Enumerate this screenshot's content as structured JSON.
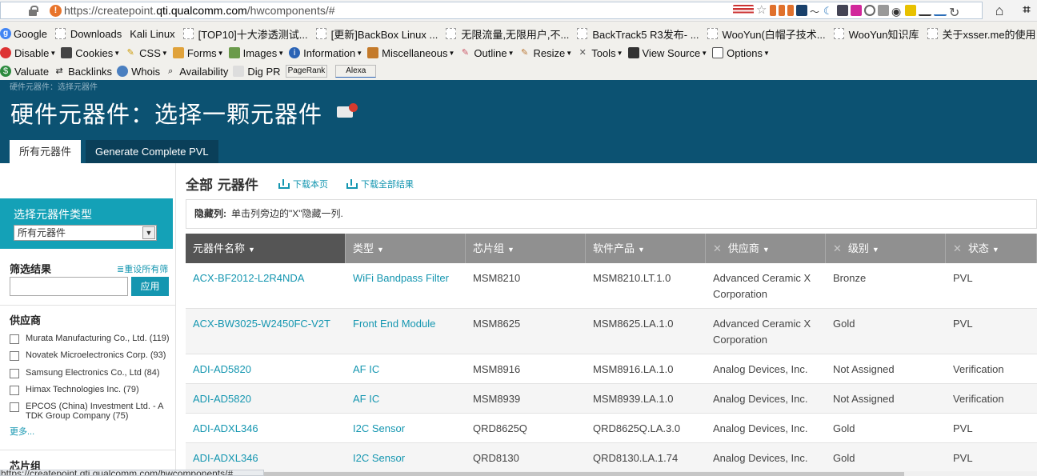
{
  "browser": {
    "url_prefix": "https://createpoint.",
    "url_host": "qti.qualcomm.com",
    "url_suffix": "/hwcomponents/#",
    "bookmarks": [
      {
        "label": "Google",
        "icon": "google-icon"
      },
      {
        "label": "Downloads",
        "icon": "page-icon"
      },
      {
        "label": "Kali Linux",
        "icon": "none"
      },
      {
        "label": "[TOP10]十大渗透测试...",
        "icon": "page-icon"
      },
      {
        "label": "[更新]BackBox Linux ...",
        "icon": "page-icon"
      },
      {
        "label": "无限流量,无限用户,不...",
        "icon": "page-icon"
      },
      {
        "label": "BackTrack5 R3发布- ...",
        "icon": "page-icon"
      },
      {
        "label": "WooYun(白帽子技术...",
        "icon": "page-icon"
      },
      {
        "label": "WooYun知识库",
        "icon": "page-icon"
      },
      {
        "label": "关于xsser.me的使用",
        "icon": "page-icon"
      }
    ],
    "toolbar1": [
      "Disable",
      "Cookies",
      "CSS",
      "Forms",
      "Images",
      "Information",
      "Miscellaneous",
      "Outline",
      "Resize",
      "Tools",
      "View Source",
      "Options"
    ],
    "toolbar2": [
      "Valuate",
      "Backlinks",
      "Whois",
      "Availability",
      "Dig PR"
    ],
    "rank_labels": [
      "PageRank",
      "Alexa"
    ],
    "status_url": "https://createpoint.qti.qualcomm.com/hwcomponents/#"
  },
  "header": {
    "breadcrumb": "硬件元器件：选择元器件",
    "title": "硬件元器件：选择一颗元器件",
    "tabs": [
      "所有元器件",
      "Generate Complete PVL"
    ]
  },
  "sidebar": {
    "type_label": "选择元器件类型",
    "type_value": "所有元器件",
    "filter_title": "筛选结果",
    "reset_label": "重设所有筛选",
    "apply_label": "应用",
    "supplier_title": "供应商",
    "suppliers": [
      "Murata Manufacturing Co., Ltd. (119)",
      "Novatek Microelectronics Corp. (93)",
      "Samsung Electronics Co., Ltd (84)",
      "Himax Technologies Inc. (79)",
      "EPCOS (China) Investment Ltd. - A TDK Group Company (75)"
    ],
    "more_label": "更多...",
    "chipset_title": "芯片组"
  },
  "main": {
    "title": "全部 元器件",
    "download_page": "下载本页",
    "download_all": "下载全部结果",
    "hide_label": "隐藏列:",
    "hide_text": "单击列旁边的\"X\"隐藏一列.",
    "columns": [
      "元器件名称",
      "类型",
      "芯片组",
      "软件产品",
      "供应商",
      "级别",
      "状态"
    ],
    "rows": [
      [
        "ACX-BF2012-L2R4NDA",
        "WiFi Bandpass Filter",
        "MSM8210",
        "MSM8210.LT.1.0",
        "Advanced Ceramic X Corporation",
        "Bronze",
        "PVL"
      ],
      [
        "ACX-BW3025-W2450FC-V2T",
        "Front End Module",
        "MSM8625",
        "MSM8625.LA.1.0",
        "Advanced Ceramic X Corporation",
        "Gold",
        "PVL"
      ],
      [
        "ADI-AD5820",
        "AF IC",
        "MSM8916",
        "MSM8916.LA.1.0",
        "Analog Devices, Inc.",
        "Not Assigned",
        "Verification"
      ],
      [
        "ADI-AD5820",
        "AF IC",
        "MSM8939",
        "MSM8939.LA.1.0",
        "Analog Devices, Inc.",
        "Not Assigned",
        "Verification"
      ],
      [
        "ADI-ADXL346",
        "I2C Sensor",
        "QRD8625Q",
        "QRD8625Q.LA.3.0",
        "Analog Devices, Inc.",
        "Gold",
        "PVL"
      ],
      [
        "ADI-ADXL346",
        "I2C Sensor",
        "QRD8130",
        "QRD8130.LA.1.74",
        "Analog Devices, Inc.",
        "Gold",
        "PVL"
      ]
    ]
  }
}
